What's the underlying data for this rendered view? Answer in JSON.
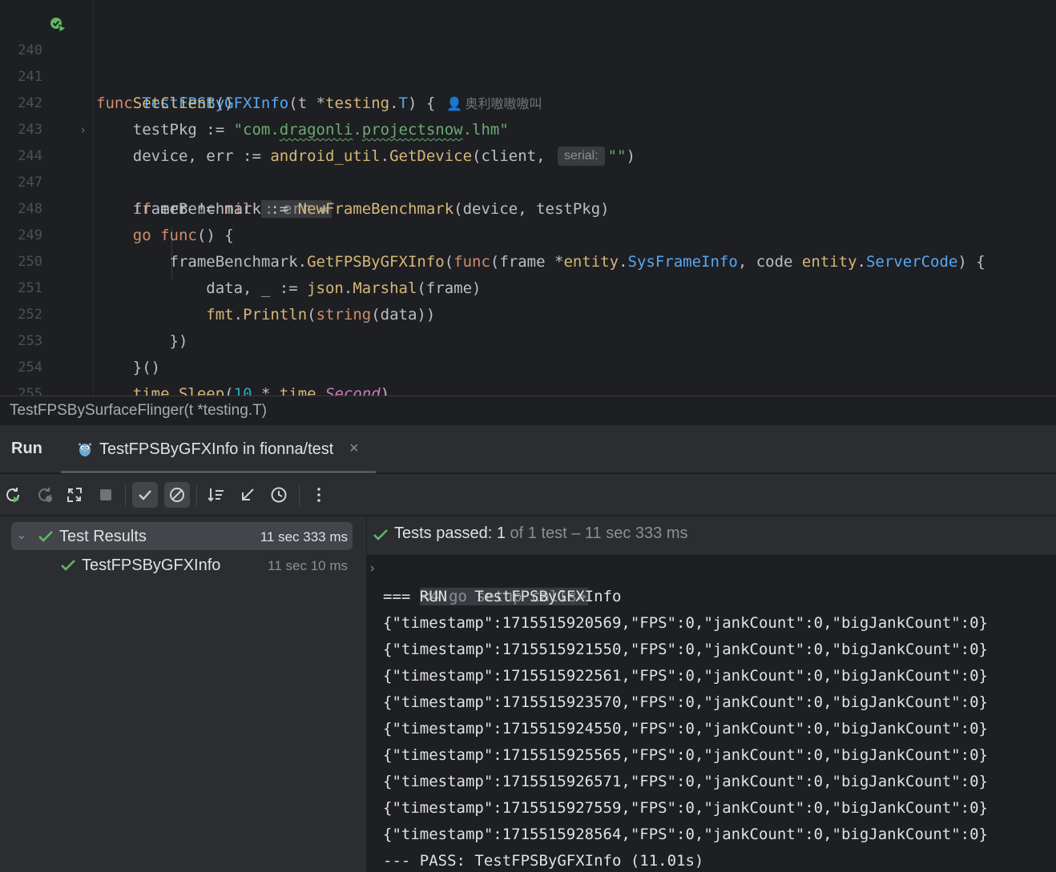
{
  "editor": {
    "lines": [
      {
        "n": "240"
      },
      {
        "n": "241"
      },
      {
        "n": "242"
      },
      {
        "n": "243"
      },
      {
        "n": "244"
      },
      {
        "n": "247"
      },
      {
        "n": "248"
      },
      {
        "n": "249"
      },
      {
        "n": "250"
      },
      {
        "n": "251"
      },
      {
        "n": "252"
      },
      {
        "n": "253"
      },
      {
        "n": "254"
      },
      {
        "n": "255"
      }
    ],
    "author": "奥利嗷嗷嗷叫",
    "param_hint": "serial:",
    "folded_text": ": err ✱"
  },
  "breadcrumb": "TestFPSBySurfaceFlinger(t *testing.T)",
  "run_window": {
    "title": "Run",
    "tab_label": "TestFPSByGFXInfo in fionna/test",
    "tab_close": "×"
  },
  "tests": {
    "root_label": "Test Results",
    "root_time": "11 sec 333 ms",
    "child_label": "TestFPSByGFXInfo",
    "child_time": "11 sec 10 ms"
  },
  "console": {
    "status_main": "Tests passed: 1",
    "status_detail": " of 1 test – 11 sec 333 ms",
    "setup_calls": "<4 go setup calls>",
    "run_line": "=== RUN   TestFPSByGFXInfo",
    "output_lines": [
      "{\"timestamp\":1715515920569,\"FPS\":0,\"jankCount\":0,\"bigJankCount\":0}",
      "{\"timestamp\":1715515921550,\"FPS\":0,\"jankCount\":0,\"bigJankCount\":0}",
      "{\"timestamp\":1715515922561,\"FPS\":0,\"jankCount\":0,\"bigJankCount\":0}",
      "{\"timestamp\":1715515923570,\"FPS\":0,\"jankCount\":0,\"bigJankCount\":0}",
      "{\"timestamp\":1715515924550,\"FPS\":0,\"jankCount\":0,\"bigJankCount\":0}",
      "{\"timestamp\":1715515925565,\"FPS\":0,\"jankCount\":0,\"bigJankCount\":0}",
      "{\"timestamp\":1715515926571,\"FPS\":0,\"jankCount\":0,\"bigJankCount\":0}",
      "{\"timestamp\":1715515927559,\"FPS\":0,\"jankCount\":0,\"bigJankCount\":0}",
      "{\"timestamp\":1715515928564,\"FPS\":0,\"jankCount\":0,\"bigJankCount\":0}"
    ],
    "pass_line": "--- PASS: TestFPSByGFXInfo (11.01s)"
  },
  "colors": {
    "success": "#5fb865",
    "background": "#1e1f22",
    "panel": "#2b2d30"
  }
}
